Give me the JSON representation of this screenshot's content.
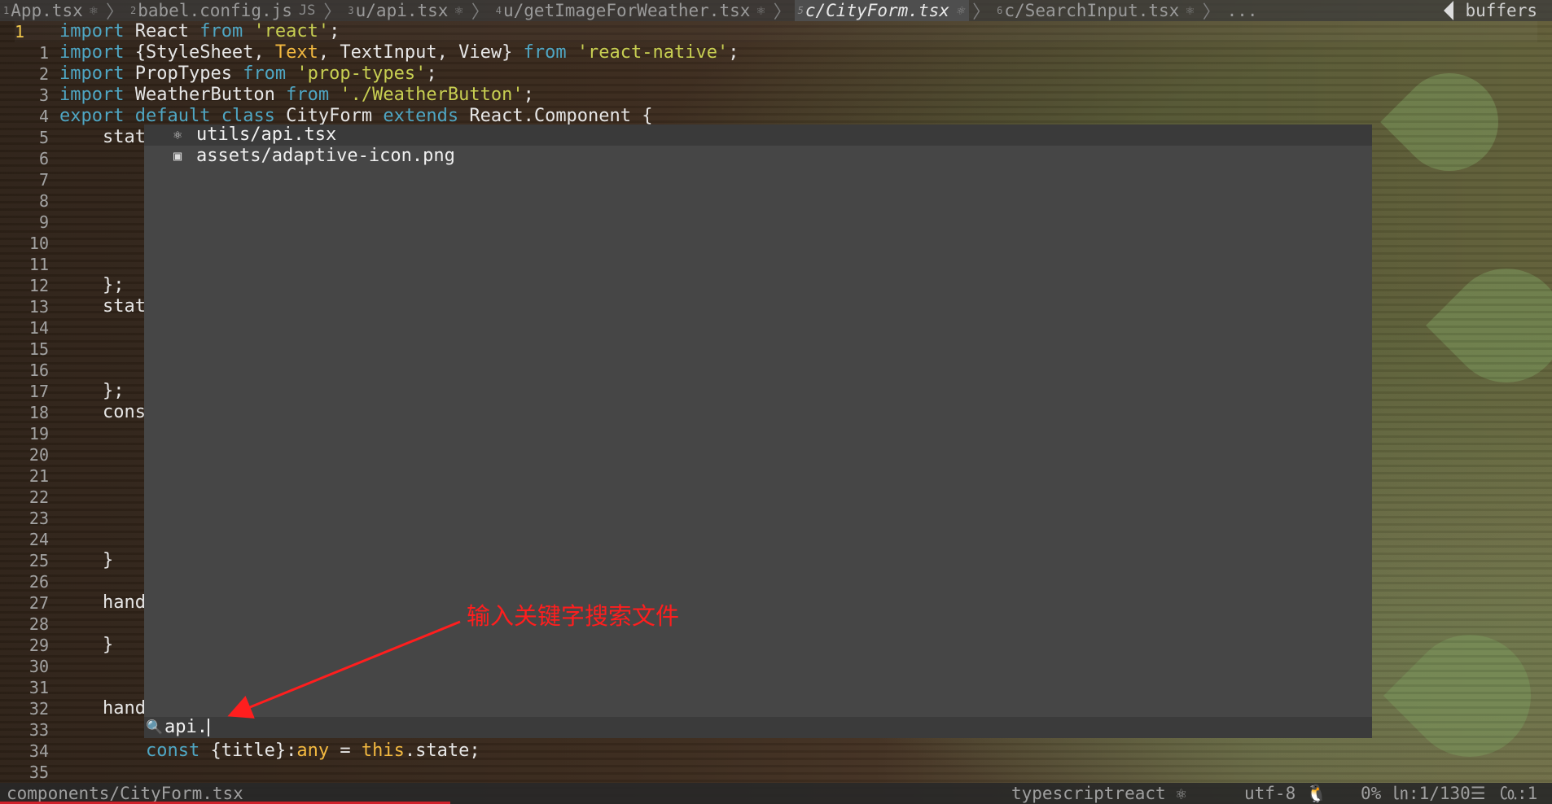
{
  "tabline": {
    "tabs": [
      {
        "num": "1",
        "label": "App.tsx",
        "icon": "⚛",
        "active": false
      },
      {
        "num": "2",
        "label": "babel.config.js",
        "icon": "JS",
        "active": false
      },
      {
        "num": "3",
        "label": "u/api.tsx",
        "icon": "⚛",
        "active": false
      },
      {
        "num": "4",
        "label": "u/getImageForWeather.tsx",
        "icon": "⚛",
        "active": false
      },
      {
        "num": "5",
        "label": "c/CityForm.tsx",
        "icon": "⚛",
        "active": true
      },
      {
        "num": "6",
        "label": "c/SearchInput.tsx",
        "icon": "⚛",
        "active": false
      }
    ],
    "overflow": "...",
    "buffers_label": "buffers"
  },
  "editor": {
    "lines": [
      {
        "num": "1",
        "text": "import React from 'react';"
      },
      {
        "num": "1",
        "text": "import {StyleSheet, Text, TextInput, View} from 'react-native';"
      },
      {
        "num": "2",
        "text": "import PropTypes from 'prop-types';"
      },
      {
        "num": "3",
        "text": "import WeatherButton from './WeatherButton';"
      },
      {
        "num": "4",
        "text": "export default class CityForm extends React.Component {"
      },
      {
        "num": "5",
        "text": "    stat"
      },
      {
        "num": "6",
        "text": ""
      },
      {
        "num": "7",
        "text": ""
      },
      {
        "num": "8",
        "text": ""
      },
      {
        "num": "9",
        "text": ""
      },
      {
        "num": "10",
        "text": ""
      },
      {
        "num": "11",
        "text": ""
      },
      {
        "num": "12",
        "text": "    };"
      },
      {
        "num": "13",
        "text": "    stat"
      },
      {
        "num": "14",
        "text": ""
      },
      {
        "num": "15",
        "text": ""
      },
      {
        "num": "16",
        "text": ""
      },
      {
        "num": "17",
        "text": "    };"
      },
      {
        "num": "18",
        "text": "    cons"
      },
      {
        "num": "19",
        "text": ""
      },
      {
        "num": "20",
        "text": ""
      },
      {
        "num": "21",
        "text": ""
      },
      {
        "num": "22",
        "text": ""
      },
      {
        "num": "23",
        "text": ""
      },
      {
        "num": "24",
        "text": ""
      },
      {
        "num": "25",
        "text": "    }"
      },
      {
        "num": "26",
        "text": ""
      },
      {
        "num": "27",
        "text": "    hand"
      },
      {
        "num": "28",
        "text": ""
      },
      {
        "num": "29",
        "text": "    }"
      },
      {
        "num": "30",
        "text": ""
      },
      {
        "num": "31",
        "text": ""
      },
      {
        "num": "32",
        "text": "    hand"
      },
      {
        "num": "33",
        "text": ""
      },
      {
        "num": "34",
        "text": "        const {title}:any = this.state;"
      },
      {
        "num": "35",
        "text": ""
      }
    ]
  },
  "finder": {
    "items": [
      {
        "icon": "⚛",
        "label": "utils/api.tsx",
        "selected": true
      },
      {
        "icon": "▣",
        "label": "assets/adaptive-icon.png",
        "selected": false
      }
    ],
    "prompt_icon": "🔍",
    "query": "api."
  },
  "annotation": {
    "text": "输入关键字搜索文件",
    "color": "#ff1e1e"
  },
  "statusline": {
    "file_path": "components/CityForm.tsx",
    "filetype": "typescriptreact ⚛",
    "encoding": "utf-8 ",
    "position": "0% ㏑:1/130☰",
    "column": "㏇:1"
  },
  "colors": {
    "keyword": "#4fa6c3",
    "string": "#c8cf52",
    "type": "#f3b940",
    "current_line_number": "#f2c84b",
    "popup_bg": "#464646"
  }
}
